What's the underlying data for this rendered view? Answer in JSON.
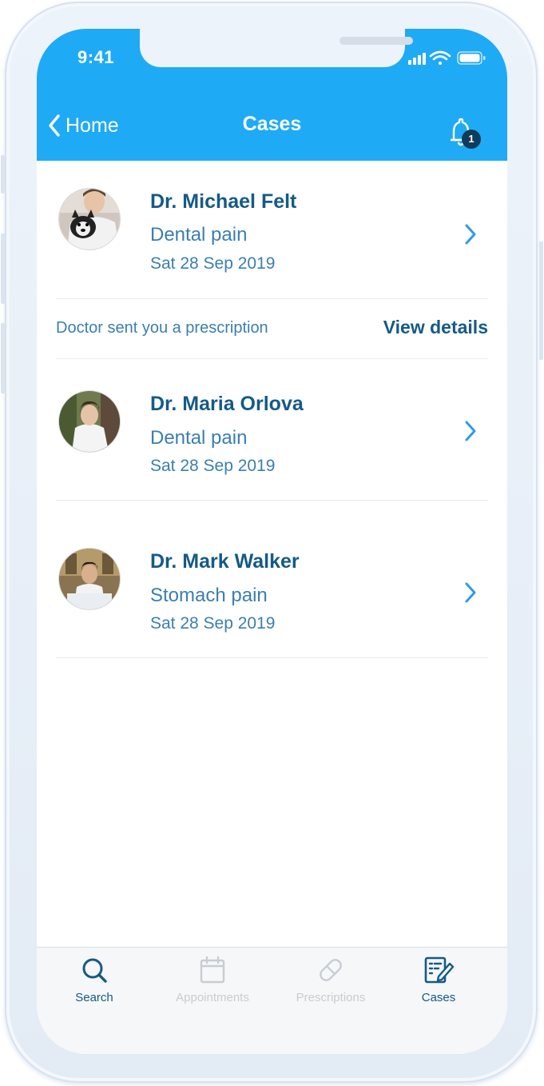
{
  "status_bar": {
    "time": "9:41"
  },
  "nav": {
    "back_label": "Home",
    "title": "Cases",
    "notification_count": "1"
  },
  "cases": [
    {
      "doctor": "Dr. Michael Felt",
      "title": "Dental pain",
      "date": "Sat 28 Sep 2019"
    },
    {
      "doctor": "Dr. Maria Orlova",
      "title": "Dental pain",
      "date": "Sat 28 Sep 2019"
    },
    {
      "doctor": "Dr. Mark Walker",
      "title": "Stomach pain",
      "date": "Sat 28 Sep 2019"
    }
  ],
  "notice": {
    "text": "Doctor sent you a prescription",
    "link": "View details"
  },
  "tabs": [
    {
      "label": "Search",
      "icon": "search-icon",
      "active": true
    },
    {
      "label": "Appointments",
      "icon": "calendar-icon",
      "active": false
    },
    {
      "label": "Prescriptions",
      "icon": "pill-icon",
      "active": false
    },
    {
      "label": "Cases",
      "icon": "cases-icon",
      "active": true
    }
  ],
  "colors": {
    "header": "#1faaf5",
    "primary_text": "#155a86",
    "secondary_text": "#3a7fb0",
    "chevron": "#2e9be8",
    "inactive_tab": "#c7cdd3"
  }
}
